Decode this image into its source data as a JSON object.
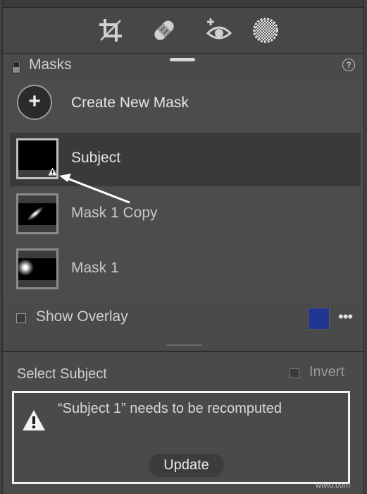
{
  "toolbar": {
    "tools": [
      {
        "icon": "crop-icon"
      },
      {
        "icon": "healing-icon"
      },
      {
        "icon": "red-eye-icon"
      },
      {
        "icon": "masking-icon",
        "active": true
      }
    ]
  },
  "masks": {
    "title": "Masks",
    "help_icon": "?",
    "create_label": "Create New Mask",
    "create_icon": "+",
    "items": [
      {
        "name": "Subject",
        "selected": true,
        "warning": true
      },
      {
        "name": "Mask 1 Copy",
        "selected": false
      },
      {
        "name": "Mask 1",
        "selected": false
      }
    ],
    "show_overlay_label": "Show Overlay",
    "overlay_color": "#1e3592",
    "more_label": "•••"
  },
  "subject_panel": {
    "title": "Select Subject",
    "invert_label": "Invert",
    "warning_text": "“Subject 1” needs to be recomputed",
    "update_label": "Update"
  },
  "watermark": "wtvid.com"
}
